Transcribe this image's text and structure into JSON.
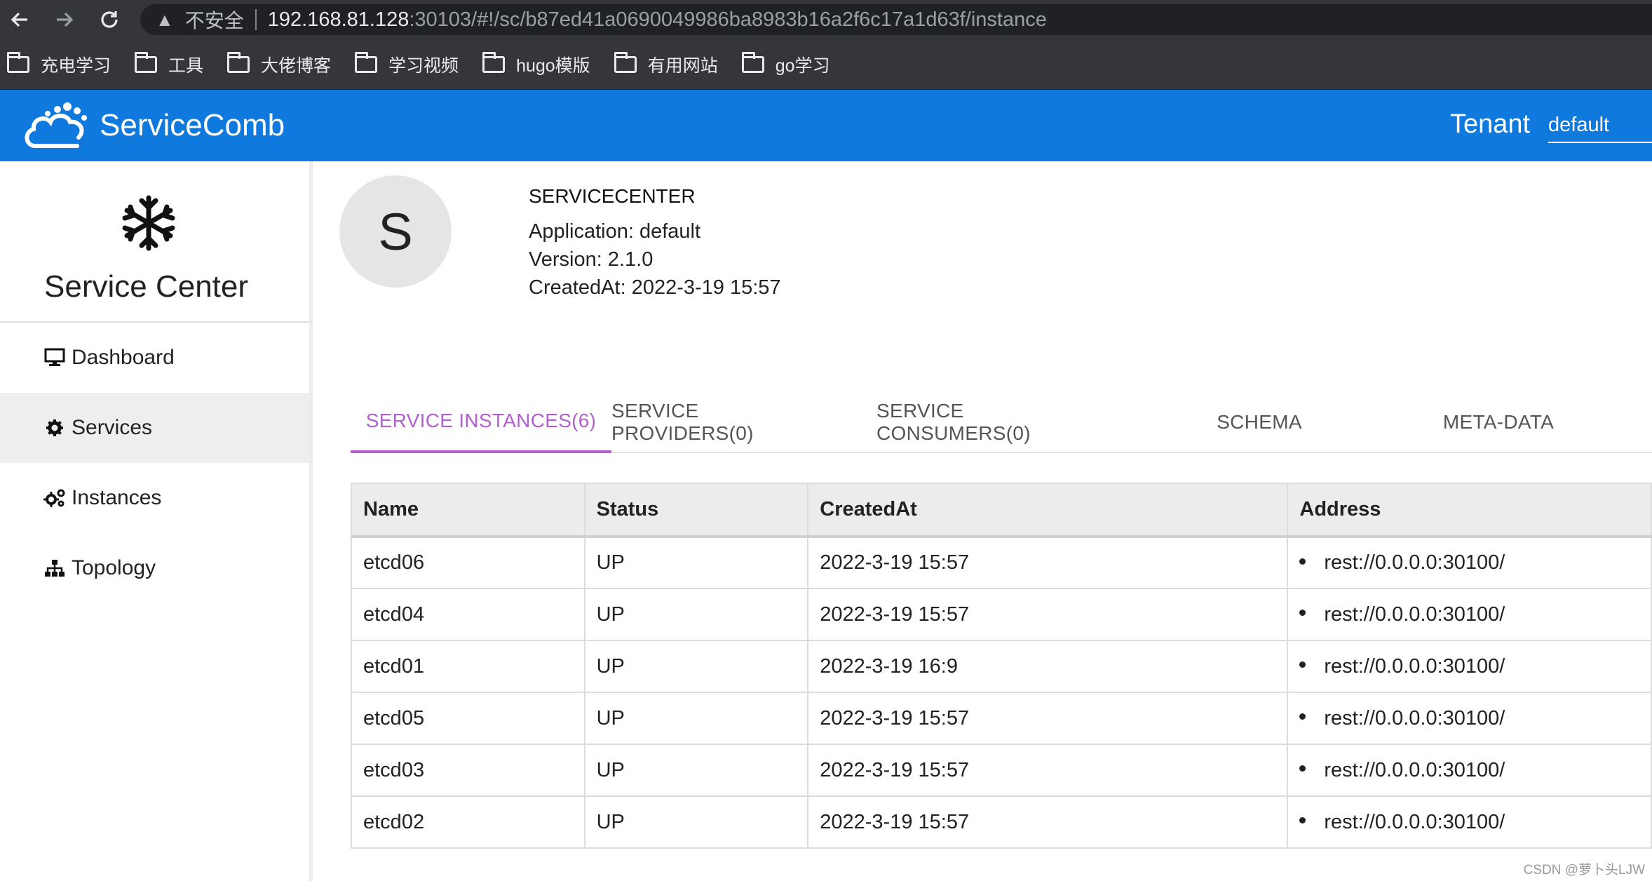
{
  "browser": {
    "back_icon": "arrow-left-icon",
    "forward_icon": "arrow-right-icon",
    "reload_icon": "reload-icon",
    "security_label": "不安全",
    "url_host": "192.168.81.128",
    "url_rest": ":30103/#!/sc/b87ed41a0690049986ba8983b16a2f6c17a1d63f/instance"
  },
  "bookmarks": [
    {
      "label": "充电学习"
    },
    {
      "label": "工具"
    },
    {
      "label": "大佬博客"
    },
    {
      "label": "学习视频"
    },
    {
      "label": "hugo模版"
    },
    {
      "label": "有用网站"
    },
    {
      "label": "go学习"
    }
  ],
  "header": {
    "logo_text": "ServiceComb",
    "tenant_label": "Tenant",
    "tenant_value": "default",
    "bg_color": "#1079dd"
  },
  "sidebar": {
    "title": "Service Center",
    "items": [
      {
        "label": "Dashboard",
        "icon": "monitor-icon",
        "active": false
      },
      {
        "label": "Services",
        "icon": "gear-icon",
        "active": true
      },
      {
        "label": "Instances",
        "icon": "gears-icon",
        "active": false
      },
      {
        "label": "Topology",
        "icon": "sitemap-icon",
        "active": false
      }
    ]
  },
  "service": {
    "avatar_letter": "S",
    "name": "SERVICECENTER",
    "application": "Application: default",
    "version": "Version: 2.1.0",
    "created_at": "CreatedAt: 2022-3-19 15:57"
  },
  "tabs": [
    {
      "label": "SERVICE INSTANCES(6)",
      "active": true
    },
    {
      "label": "SERVICE PROVIDERS(0)",
      "active": false
    },
    {
      "label": "SERVICE CONSUMERS(0)",
      "active": false
    },
    {
      "label": "SCHEMA",
      "active": false
    },
    {
      "label": "META-DATA",
      "active": false
    }
  ],
  "table": {
    "headers": [
      "Name",
      "Status",
      "CreatedAt",
      "Address"
    ],
    "rows": [
      [
        "etcd06",
        "UP",
        "2022-3-19 15:57",
        "rest://0.0.0.0:30100/"
      ],
      [
        "etcd04",
        "UP",
        "2022-3-19 15:57",
        "rest://0.0.0.0:30100/"
      ],
      [
        "etcd01",
        "UP",
        "2022-3-19 16:9",
        "rest://0.0.0.0:30100/"
      ],
      [
        "etcd05",
        "UP",
        "2022-3-19 15:57",
        "rest://0.0.0.0:30100/"
      ],
      [
        "etcd03",
        "UP",
        "2022-3-19 15:57",
        "rest://0.0.0.0:30100/"
      ],
      [
        "etcd02",
        "UP",
        "2022-3-19 15:57",
        "rest://0.0.0.0:30100/"
      ]
    ]
  },
  "watermark": "CSDN @萝卜头LJW",
  "colors": {
    "accent": "#b25fcf",
    "header": "#1079dd"
  }
}
